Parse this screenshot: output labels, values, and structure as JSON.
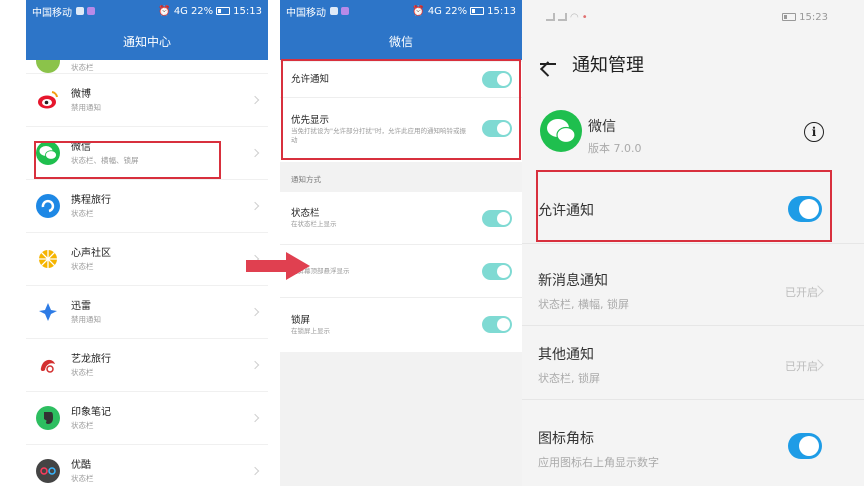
{
  "panel1": {
    "status": {
      "carrier": "中国移动",
      "signal": "4G",
      "battery": "22%",
      "time": "15:13"
    },
    "title": "通知中心",
    "apps": [
      {
        "name": "",
        "sub": "状态栏",
        "icon": "game-icon",
        "color": "#8bc34a"
      },
      {
        "name": "微博",
        "sub": "禁用通知",
        "icon": "weibo-icon",
        "color": "#e6162d"
      },
      {
        "name": "微信",
        "sub": "状态栏、横幅、锁屏",
        "icon": "wechat-icon",
        "color": "#1fbf4e"
      },
      {
        "name": "携程旅行",
        "sub": "状态栏",
        "icon": "ctrip-icon",
        "color": "#1e88e5"
      },
      {
        "name": "心声社区",
        "sub": "状态栏",
        "icon": "community-icon",
        "color": "#f5b400"
      },
      {
        "name": "迅雷",
        "sub": "禁用通知",
        "icon": "xunlei-icon",
        "color": "#2d7be5"
      },
      {
        "name": "艺龙旅行",
        "sub": "状态栏",
        "icon": "elong-icon",
        "color": "#d32f2f"
      },
      {
        "name": "印象笔记",
        "sub": "状态栏",
        "icon": "evernote-icon",
        "color": "#2dbe60"
      },
      {
        "name": "优酷",
        "sub": "状态栏",
        "icon": "youku-icon",
        "color": "#444444"
      }
    ]
  },
  "panel2": {
    "status": {
      "carrier": "中国移动",
      "signal": "4G",
      "battery": "22%",
      "time": "15:13"
    },
    "title": "微信",
    "allow": {
      "label": "允许通知",
      "on": true
    },
    "priority": {
      "label": "优先显示",
      "desc": "当免打扰设为\"允许部分打扰\"时，允许此应用的通知响铃或振动",
      "on": true
    },
    "section_label": "通知方式",
    "methods": [
      {
        "label": "状态栏",
        "desc": "在状态栏上显示",
        "on": true
      },
      {
        "label": "",
        "desc": "在屏幕顶部悬浮显示",
        "on": true
      },
      {
        "label": "锁屏",
        "desc": "在锁屏上显示",
        "on": true
      }
    ]
  },
  "panel3": {
    "status": {
      "time": "15:23"
    },
    "title": "通知管理",
    "app_name": "微信",
    "version": "版本 7.0.0",
    "allow": {
      "label": "允许通知",
      "on": true
    },
    "rows": [
      {
        "title": "新消息通知",
        "sub": "状态栏, 横幅, 锁屏",
        "value": "已开启"
      },
      {
        "title": "其他通知",
        "sub": "状态栏, 锁屏",
        "value": "已开启"
      }
    ],
    "badge": {
      "title": "图标角标",
      "sub": "应用图标右上角显示数字",
      "on": true
    }
  },
  "colors": {
    "header_blue": "#2d75c8",
    "highlight_red": "#d8303d",
    "toggle_teal": "#7fdad3",
    "toggle_blue": "#1e9ce6",
    "arrow_red": "#e04050"
  }
}
